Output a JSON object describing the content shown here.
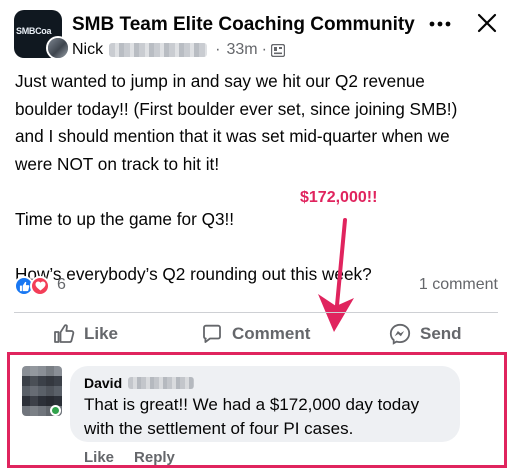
{
  "post": {
    "group_name": "SMB Team Elite Coaching Community",
    "group_logo_text": "SMBCoa",
    "author": "Nick",
    "time": "33m",
    "separator": "·",
    "body": [
      "Just wanted to jump in and say we hit our Q2 revenue",
      "boulder today!! (First boulder ever set, since joining SMB!)",
      "and I should mention that it was set mid-quarter when we",
      "were NOT on track to hit it!",
      "",
      "Time to up the game for Q3!!",
      "",
      "How’s everybody’s Q2 rounding out this week?"
    ]
  },
  "annotation": {
    "text": "$172,000!!",
    "color": "#e0245e"
  },
  "reactions": {
    "count": "6",
    "comments": "1 comment",
    "like_color": "#1877f2",
    "love_color": "#f33e58"
  },
  "actions": {
    "like": "Like",
    "comment": "Comment",
    "send": "Send"
  },
  "comment": {
    "author": "David",
    "text_line1": "That is great!! We had a $172,000 day today",
    "text_line2": "with the settlement of four PI cases.",
    "like": "Like",
    "reply": "Reply"
  },
  "icons": {
    "more": "more-dots-icon",
    "close": "close-icon",
    "group": "group-icon",
    "like": "thumbs-up-icon",
    "comment": "speech-bubble-icon",
    "send": "messenger-icon"
  }
}
